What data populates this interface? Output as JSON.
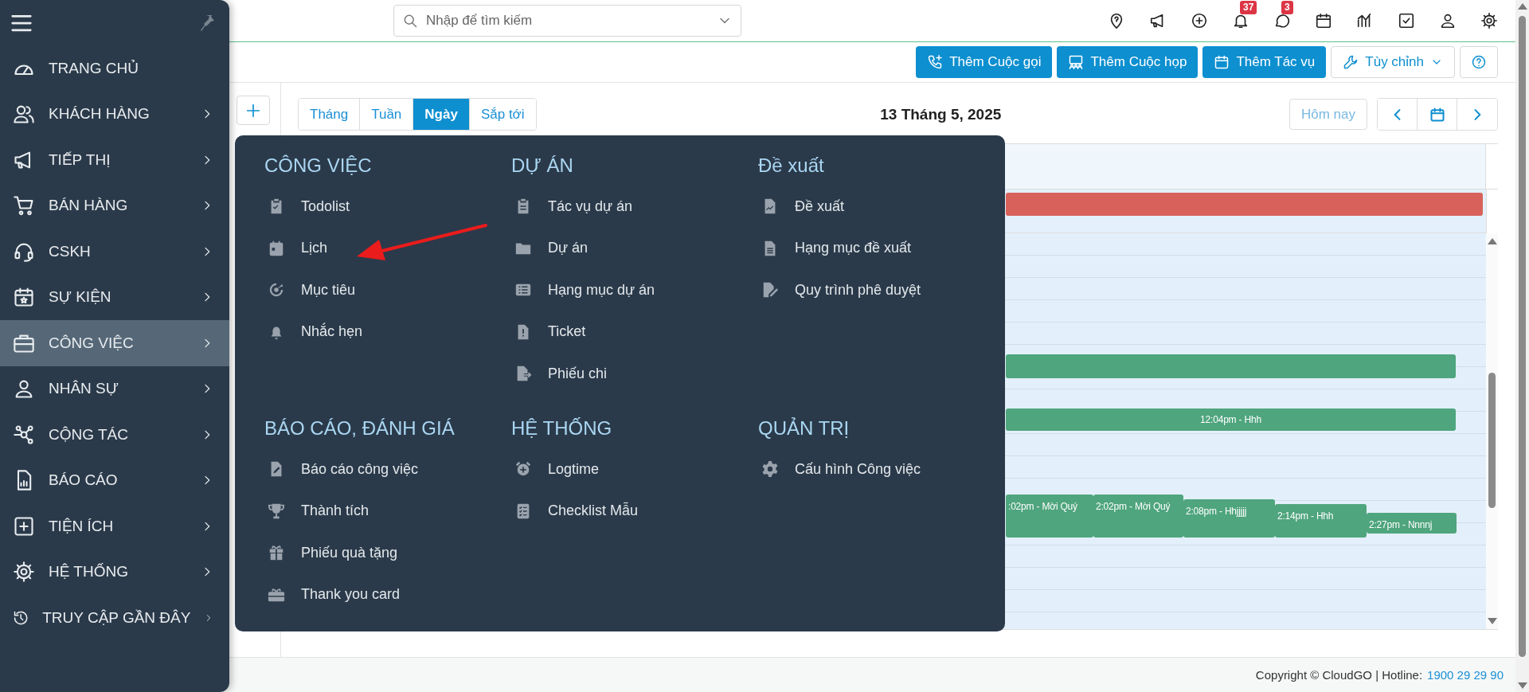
{
  "sidebar": {
    "items": [
      {
        "label": "TRANG CHỦ",
        "selected": false,
        "has_submenu": false
      },
      {
        "label": "KHÁCH HÀNG",
        "selected": false,
        "has_submenu": true
      },
      {
        "label": "TIẾP THỊ",
        "selected": false,
        "has_submenu": true
      },
      {
        "label": "BÁN HÀNG",
        "selected": false,
        "has_submenu": true
      },
      {
        "label": "CSKH",
        "selected": false,
        "has_submenu": true
      },
      {
        "label": "SỰ KIỆN",
        "selected": false,
        "has_submenu": true
      },
      {
        "label": "CÔNG VIỆC",
        "selected": true,
        "has_submenu": true
      },
      {
        "label": "NHÂN SỰ",
        "selected": false,
        "has_submenu": true
      },
      {
        "label": "CỘNG TÁC",
        "selected": false,
        "has_submenu": true
      },
      {
        "label": "BÁO CÁO",
        "selected": false,
        "has_submenu": true
      },
      {
        "label": "TIỆN ÍCH",
        "selected": false,
        "has_submenu": true
      },
      {
        "label": "HỆ THỐNG",
        "selected": false,
        "has_submenu": true
      },
      {
        "label": "TRUY CẬP GẦN ĐÂY",
        "selected": false,
        "has_submenu": true
      }
    ]
  },
  "search": {
    "placeholder": "Nhập để tìm kiếm"
  },
  "topbar": {
    "notification_badge": "37",
    "message_badge": "3"
  },
  "actions": [
    {
      "label": "Thêm Cuộc gọi",
      "kind": "primary"
    },
    {
      "label": "Thêm Cuộc họp",
      "kind": "primary"
    },
    {
      "label": "Thêm Tác vụ",
      "kind": "primary"
    },
    {
      "label": "Tùy chỉnh",
      "kind": "outline"
    }
  ],
  "calendar": {
    "views": [
      {
        "label": "Tháng",
        "selected": false
      },
      {
        "label": "Tuần",
        "selected": false
      },
      {
        "label": "Ngày",
        "selected": true
      },
      {
        "label": "Sắp tới",
        "selected": false
      }
    ],
    "date_title": "13 Tháng 5, 2025",
    "today_button": "Hôm nay",
    "allday_events": [
      {
        "color": "#d8625b"
      }
    ],
    "events": [
      {
        "color": "#4fa57d"
      },
      {
        "text": "12:04pm - Hhh",
        "color": "#4fa57d"
      },
      {
        "text": ":02pm - Mời Quý",
        "color": "#4fa57d"
      },
      {
        "text": "2:02pm - Mời Quý",
        "color": "#4fa57d"
      },
      {
        "text": "2:08pm - Hhjjjjj",
        "color": "#4fa57d"
      },
      {
        "text": "2:14pm - Hhh",
        "color": "#4fa57d"
      },
      {
        "text": "2:27pm - Nnnnj",
        "color": "#4fa57d"
      }
    ]
  },
  "mega_menu": {
    "sections": [
      {
        "title": "CÔNG VIỆC",
        "items": [
          "Todolist",
          "Lịch",
          "Mục tiêu",
          "Nhắc hẹn"
        ]
      },
      {
        "title": "DỰ ÁN",
        "items": [
          "Tác vụ dự án",
          "Dự án",
          "Hạng mục dự án",
          "Ticket",
          "Phiếu chi"
        ]
      },
      {
        "title": "Đề xuất",
        "items": [
          "Đề xuất",
          "Hạng mục đề xuất",
          "Quy trình phê duyệt"
        ]
      },
      {
        "title": "BÁO CÁO, ĐÁNH GIÁ",
        "items": [
          "Báo cáo công việc",
          "Thành tích",
          "Phiếu quà tặng",
          "Thank you card"
        ]
      },
      {
        "title": "HỆ THỐNG",
        "items": [
          "Logtime",
          "Checklist Mẫu"
        ]
      },
      {
        "title": "QUẢN TRỊ",
        "items": [
          "Cấu hình Công việc"
        ]
      }
    ]
  },
  "footer": {
    "copyright": "Copyright © CloudGO | Hotline:",
    "hotline": "1900 29 29 90"
  }
}
